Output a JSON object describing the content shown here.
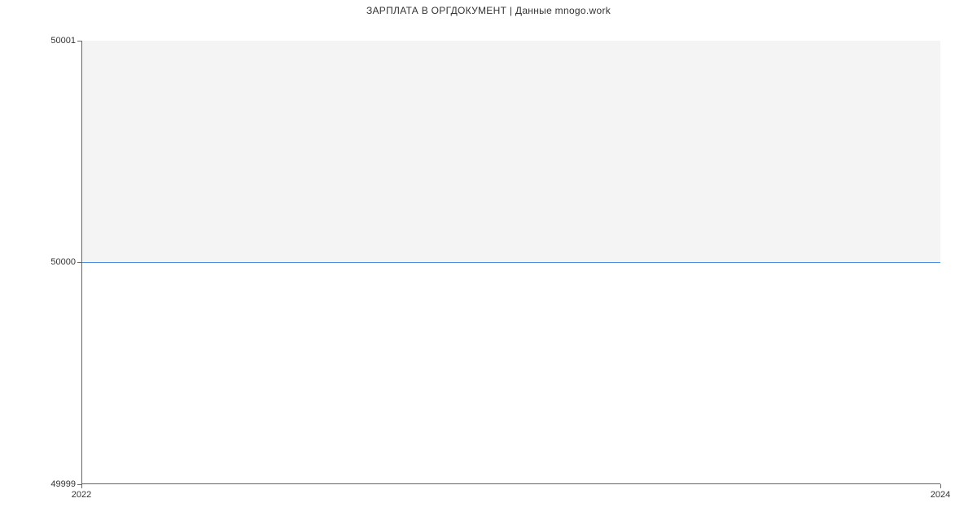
{
  "chart_data": {
    "type": "line",
    "title": "ЗАРПЛАТА В  ОРГДОКУМЕНТ | Данные mnogo.work",
    "x": [
      2022,
      2024
    ],
    "y": [
      50000,
      50000
    ],
    "xlabel": "",
    "ylabel": "",
    "xlim": [
      2022,
      2024
    ],
    "ylim": [
      49999,
      50001
    ],
    "x_ticks": [
      2022,
      2024
    ],
    "y_ticks": [
      49999,
      50000,
      50001
    ],
    "line_color": "#4a90e2",
    "plot_bg": "#f4f4f4"
  },
  "labels": {
    "y0": "49999",
    "y1": "50000",
    "y2": "50001",
    "x0": "2022",
    "x1": "2024"
  }
}
